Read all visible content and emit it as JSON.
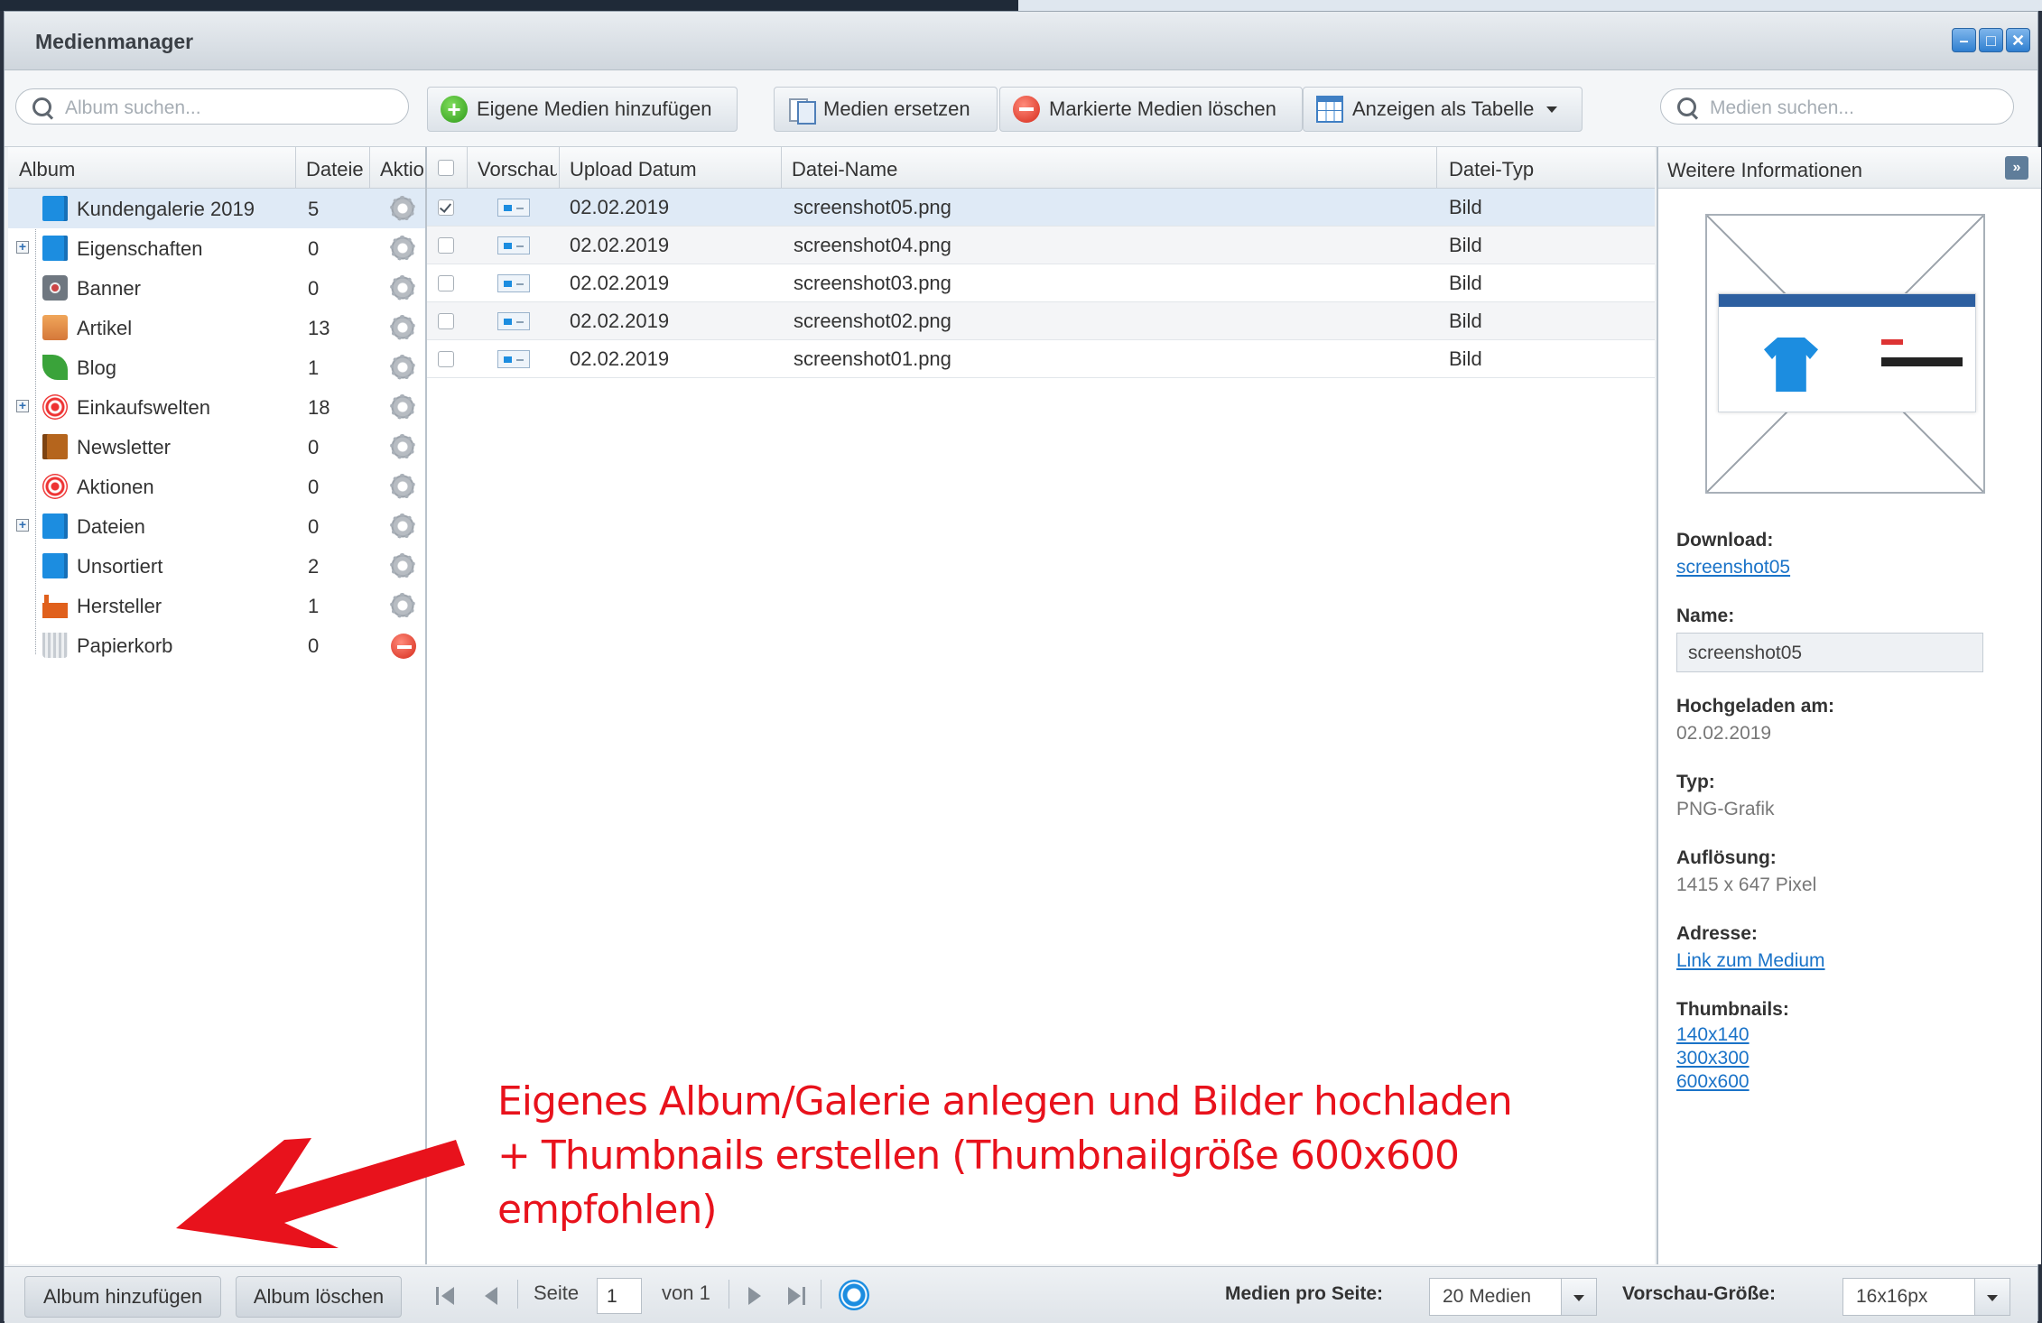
{
  "window": {
    "title": "Medienmanager"
  },
  "toolbar": {
    "album_search_placeholder": "Album suchen...",
    "add_media": "Eigene Medien hinzufügen",
    "replace_media": "Medien ersetzen",
    "delete_marked": "Markierte Medien löschen",
    "view_as_table": "Anzeigen als Tabelle",
    "media_search_placeholder": "Medien suchen..."
  },
  "album_grid": {
    "headers": {
      "album": "Album",
      "files": "Dateie",
      "action": "Aktio"
    },
    "rows": [
      {
        "label": "Kundengalerie 2019",
        "count": "5",
        "icon": "blue-folder-icon",
        "selected": true
      },
      {
        "label": "Eigenschaften",
        "count": "0",
        "icon": "blue-folder-icon",
        "expandable": true
      },
      {
        "label": "Banner",
        "count": "0",
        "icon": "camera-icon"
      },
      {
        "label": "Artikel",
        "count": "13",
        "icon": "box-icon"
      },
      {
        "label": "Blog",
        "count": "1",
        "icon": "leaf-icon"
      },
      {
        "label": "Einkaufswelten",
        "count": "18",
        "icon": "target-icon",
        "expandable": true
      },
      {
        "label": "Newsletter",
        "count": "0",
        "icon": "book-icon"
      },
      {
        "label": "Aktionen",
        "count": "0",
        "icon": "target-icon"
      },
      {
        "label": "Dateien",
        "count": "0",
        "icon": "blue-folder-icon",
        "expandable": true
      },
      {
        "label": "Unsortiert",
        "count": "2",
        "icon": "blue-folder-icon"
      },
      {
        "label": "Hersteller",
        "count": "1",
        "icon": "factory-icon"
      },
      {
        "label": "Papierkorb",
        "count": "0",
        "icon": "trash-icon"
      }
    ]
  },
  "media_grid": {
    "headers": {
      "preview": "Vorschau",
      "upload_date": "Upload Datum",
      "file_name": "Datei-Name",
      "file_type": "Datei-Typ"
    },
    "rows": [
      {
        "date": "02.02.2019",
        "name": "screenshot05.png",
        "type": "Bild",
        "checked": true
      },
      {
        "date": "02.02.2019",
        "name": "screenshot04.png",
        "type": "Bild"
      },
      {
        "date": "02.02.2019",
        "name": "screenshot03.png",
        "type": "Bild"
      },
      {
        "date": "02.02.2019",
        "name": "screenshot02.png",
        "type": "Bild"
      },
      {
        "date": "02.02.2019",
        "name": "screenshot01.png",
        "type": "Bild"
      }
    ]
  },
  "info_panel": {
    "title": "Weitere Informationen",
    "download_label": "Download:",
    "download_link": "screenshot05",
    "name_label": "Name:",
    "name_value": "screenshot05",
    "uploaded_label": "Hochgeladen am:",
    "uploaded_value": "02.02.2019",
    "type_label": "Typ:",
    "type_value": "PNG-Grafik",
    "resolution_label": "Auflösung:",
    "resolution_value": "1415 x 647 Pixel",
    "address_label": "Adresse:",
    "address_link": "Link zum Medium",
    "thumbnails_label": "Thumbnails:",
    "thumbnails": [
      "140x140",
      "300x300",
      "600x600"
    ]
  },
  "bottom": {
    "add_album": "Album hinzufügen",
    "delete_album": "Album löschen",
    "page_label": "Seite",
    "page_value": "1",
    "of_label": "von 1",
    "per_page_label": "Medien pro Seite:",
    "per_page_value": "20 Medien",
    "preview_size_label": "Vorschau-Größe:",
    "preview_size_value": "16x16px"
  },
  "annotation": {
    "line1": "Eigenes Album/Galerie anlegen und Bilder hochladen",
    "line2": "+ Thumbnails erstellen (Thumbnailgröße 600x600 empfohlen)",
    "color": "#e8121c"
  }
}
